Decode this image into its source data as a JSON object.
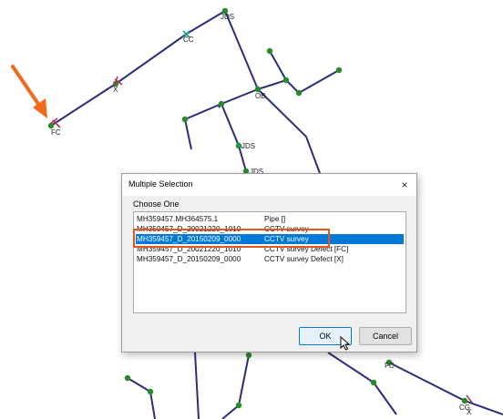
{
  "network": {
    "labels": {
      "jds_top": "JDS",
      "cc": "CC",
      "x_upper": "X",
      "fc_left": "FC",
      "ob": "OB",
      "jds_mid": "JDS",
      "jds_lower": "JDS",
      "fc_bottom": "FC",
      "cg": "CG",
      "x_bottom": "X"
    },
    "colors": {
      "pipe": "#2b2f7a",
      "node": "#2a8a2a",
      "marker": "#b0345a",
      "arrow": "#ef6a1a"
    }
  },
  "dialog": {
    "title": "Multiple Selection",
    "close_icon": "×",
    "group_label": "Choose One",
    "rows": [
      {
        "id": "MH359457.MH364575.1",
        "type": "Pipe []",
        "selected": false
      },
      {
        "id": "MH359457_D_20021220_1010",
        "type": "CCTV survey",
        "selected": false
      },
      {
        "id": "MH359457_D_20150209_0000",
        "type": "CCTV survey",
        "selected": true
      },
      {
        "id": "MH359457_D_20021220_1010",
        "type": "CCTV survey Defect [FC]",
        "selected": false
      },
      {
        "id": "MH359457_D_20150209_0000",
        "type": "CCTV survey Defect [X]",
        "selected": false
      }
    ],
    "ok_label": "OK",
    "cancel_label": "Cancel",
    "highlight_color": "#e2561f",
    "selection_color": "#0078d7"
  }
}
